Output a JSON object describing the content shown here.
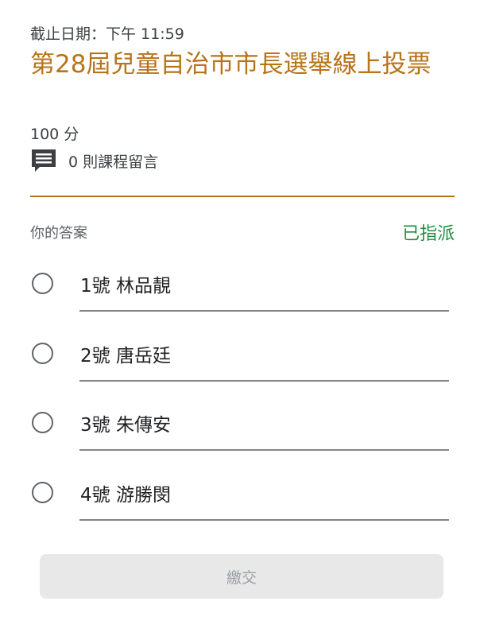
{
  "assignment": {
    "due_label": "截止日期：下午 11:59",
    "title": "第28屆兒童自治市市長選舉線上投票",
    "points": "100 分",
    "comments_label": "0 則課程留言",
    "comments_icon": "comment-icon"
  },
  "answer": {
    "label": "你的答案",
    "status": "已指派",
    "status_color": "#1e8e3e"
  },
  "options": [
    {
      "label": "1號 林品靚"
    },
    {
      "label": "2號 唐岳廷"
    },
    {
      "label": "3號 朱傳安"
    },
    {
      "label": "4號 游勝閔"
    }
  ],
  "submit": {
    "label": "繳交"
  },
  "colors": {
    "accent": "#b8741a",
    "assigned": "#1e8e3e"
  }
}
